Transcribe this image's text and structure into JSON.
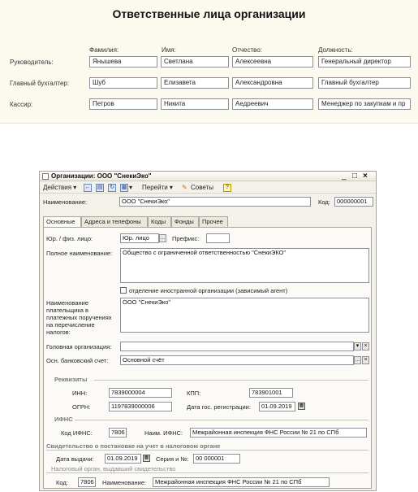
{
  "top": {
    "title": "Ответственные лица организации",
    "columns": [
      "Фамилия:",
      "Имя:",
      "Отчество:",
      "Должность:"
    ],
    "rows": [
      {
        "label": "Руководитель:",
        "values": [
          "Янышева",
          "Светлана",
          "Алексеевна",
          "Генеральный директор"
        ]
      },
      {
        "label": "Главный бухгалтер:",
        "values": [
          "Шуб",
          "Елизавета",
          "Александровна",
          "Главный бухгалтер"
        ]
      },
      {
        "label": "Кассир:",
        "values": [
          "Петров",
          "Никита",
          "Аедреевич",
          "Менеджер по закупкам и пр"
        ]
      }
    ]
  },
  "window": {
    "title": "Организации: ООО \"СнекиЭко\"",
    "controls": {
      "minimize": "_",
      "maximize": "□",
      "close": "×"
    },
    "toolbar": {
      "actions": "Действия",
      "goto": "Перейти",
      "tips": "Советы",
      "help": "?"
    },
    "name_label": "Наименование:",
    "name_value": "ООО \"СнекиЭко\"",
    "code_label": "Код:",
    "code_value": "000000001",
    "tabs": [
      "Основные",
      "Адреса и телефоны",
      "Коды",
      "Фонды",
      "Прочее"
    ],
    "main": {
      "entity_label": "Юр. / физ. лицо:",
      "entity_value": "Юр. лицо",
      "ellipsis": "...",
      "prefix_label": "Префикс:",
      "prefix_value": "",
      "fullname_label": "Полное наименование:",
      "fullname_value": "Общество с ограниченной ответственностью \"СнекиЭКО\"",
      "foreign_checkbox_label": "отделение иностранной организации (зависимый агент)",
      "payer_label": "Наименование плательщика в платежных поручениях на перечисление налогов:",
      "payer_value": "ООО \"СнекиЭко\"",
      "head_org_label": "Головная организация:",
      "head_org_value": "",
      "bank_label": "Осн. банковский счет:",
      "bank_value": "Основной счёт"
    },
    "requisites": {
      "section": "Реквизиты",
      "inn_label": "ИНН:",
      "inn_value": "7839000004",
      "kpp_label": "КПП:",
      "kpp_value": "783901001",
      "ogrn_label": "ОГРН:",
      "ogrn_value": "1197839000006",
      "regdate_label": "Дата гос. регистрации:",
      "regdate_value": "01.09.2019"
    },
    "ifns": {
      "section": "ИФНС",
      "code_label": "Код ИФНС:",
      "code_value": "7806",
      "name_label": "Наим. ИФНС:",
      "name_value": "Межрайонная инспекция ФНС России № 21 по СПб"
    },
    "certificate": {
      "section": "Свидетельство о постановке на учет в налоговом органе",
      "issue_label": "Дата выдачи:",
      "issue_value": "01.09.2019",
      "series_label": "Серия и №:",
      "series_value": "00 000001",
      "authority_label": "Налоговый орган, выдавший свидетельство",
      "code_label": "Код:",
      "code_value": "7806",
      "name_label": "Наименование:",
      "name_value": "Межрайонная инспекция ФНС России № 21 по СПб"
    }
  }
}
